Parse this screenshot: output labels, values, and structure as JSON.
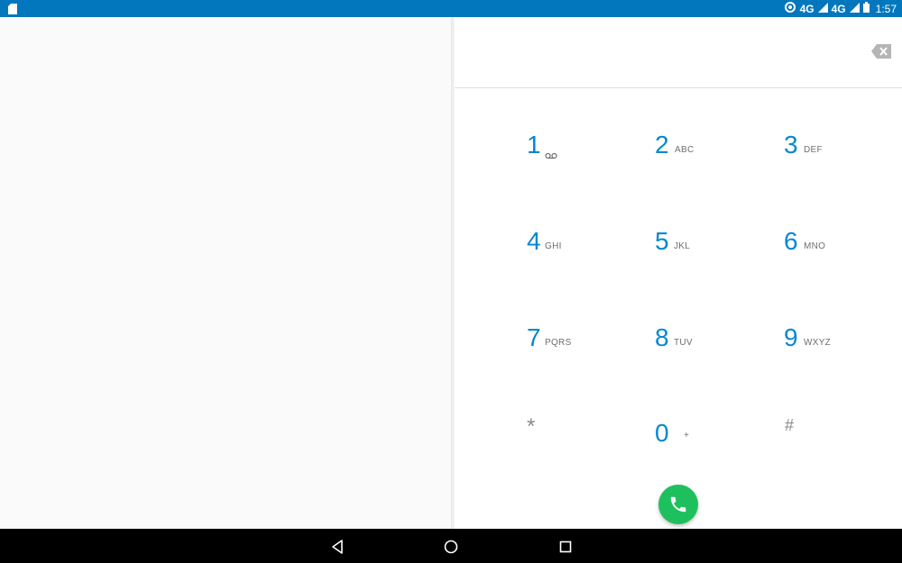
{
  "status_bar": {
    "sim_icon": "sim-card-icon",
    "network_1": "4G",
    "network_2": "4G",
    "time": "1:57",
    "background": "#0277bd"
  },
  "dialer": {
    "keys": [
      {
        "digit": "1",
        "letters": "",
        "icon": "voicemail-icon"
      },
      {
        "digit": "2",
        "letters": "ABC"
      },
      {
        "digit": "3",
        "letters": "DEF"
      },
      {
        "digit": "4",
        "letters": "GHI"
      },
      {
        "digit": "5",
        "letters": "JKL"
      },
      {
        "digit": "6",
        "letters": "MNO"
      },
      {
        "digit": "7",
        "letters": "PQRS"
      },
      {
        "digit": "8",
        "letters": "TUV"
      },
      {
        "digit": "9",
        "letters": "WXYZ"
      },
      {
        "digit": "*",
        "letters": ""
      },
      {
        "digit": "0",
        "letters": "+"
      },
      {
        "digit": "#",
        "letters": ""
      }
    ],
    "digit_color": "#0288d1",
    "call_button_color": "#1ec05e"
  },
  "nav_bar": {
    "back_icon": "back-triangle-icon",
    "home_icon": "home-circle-icon",
    "recents_icon": "recents-square-icon"
  }
}
